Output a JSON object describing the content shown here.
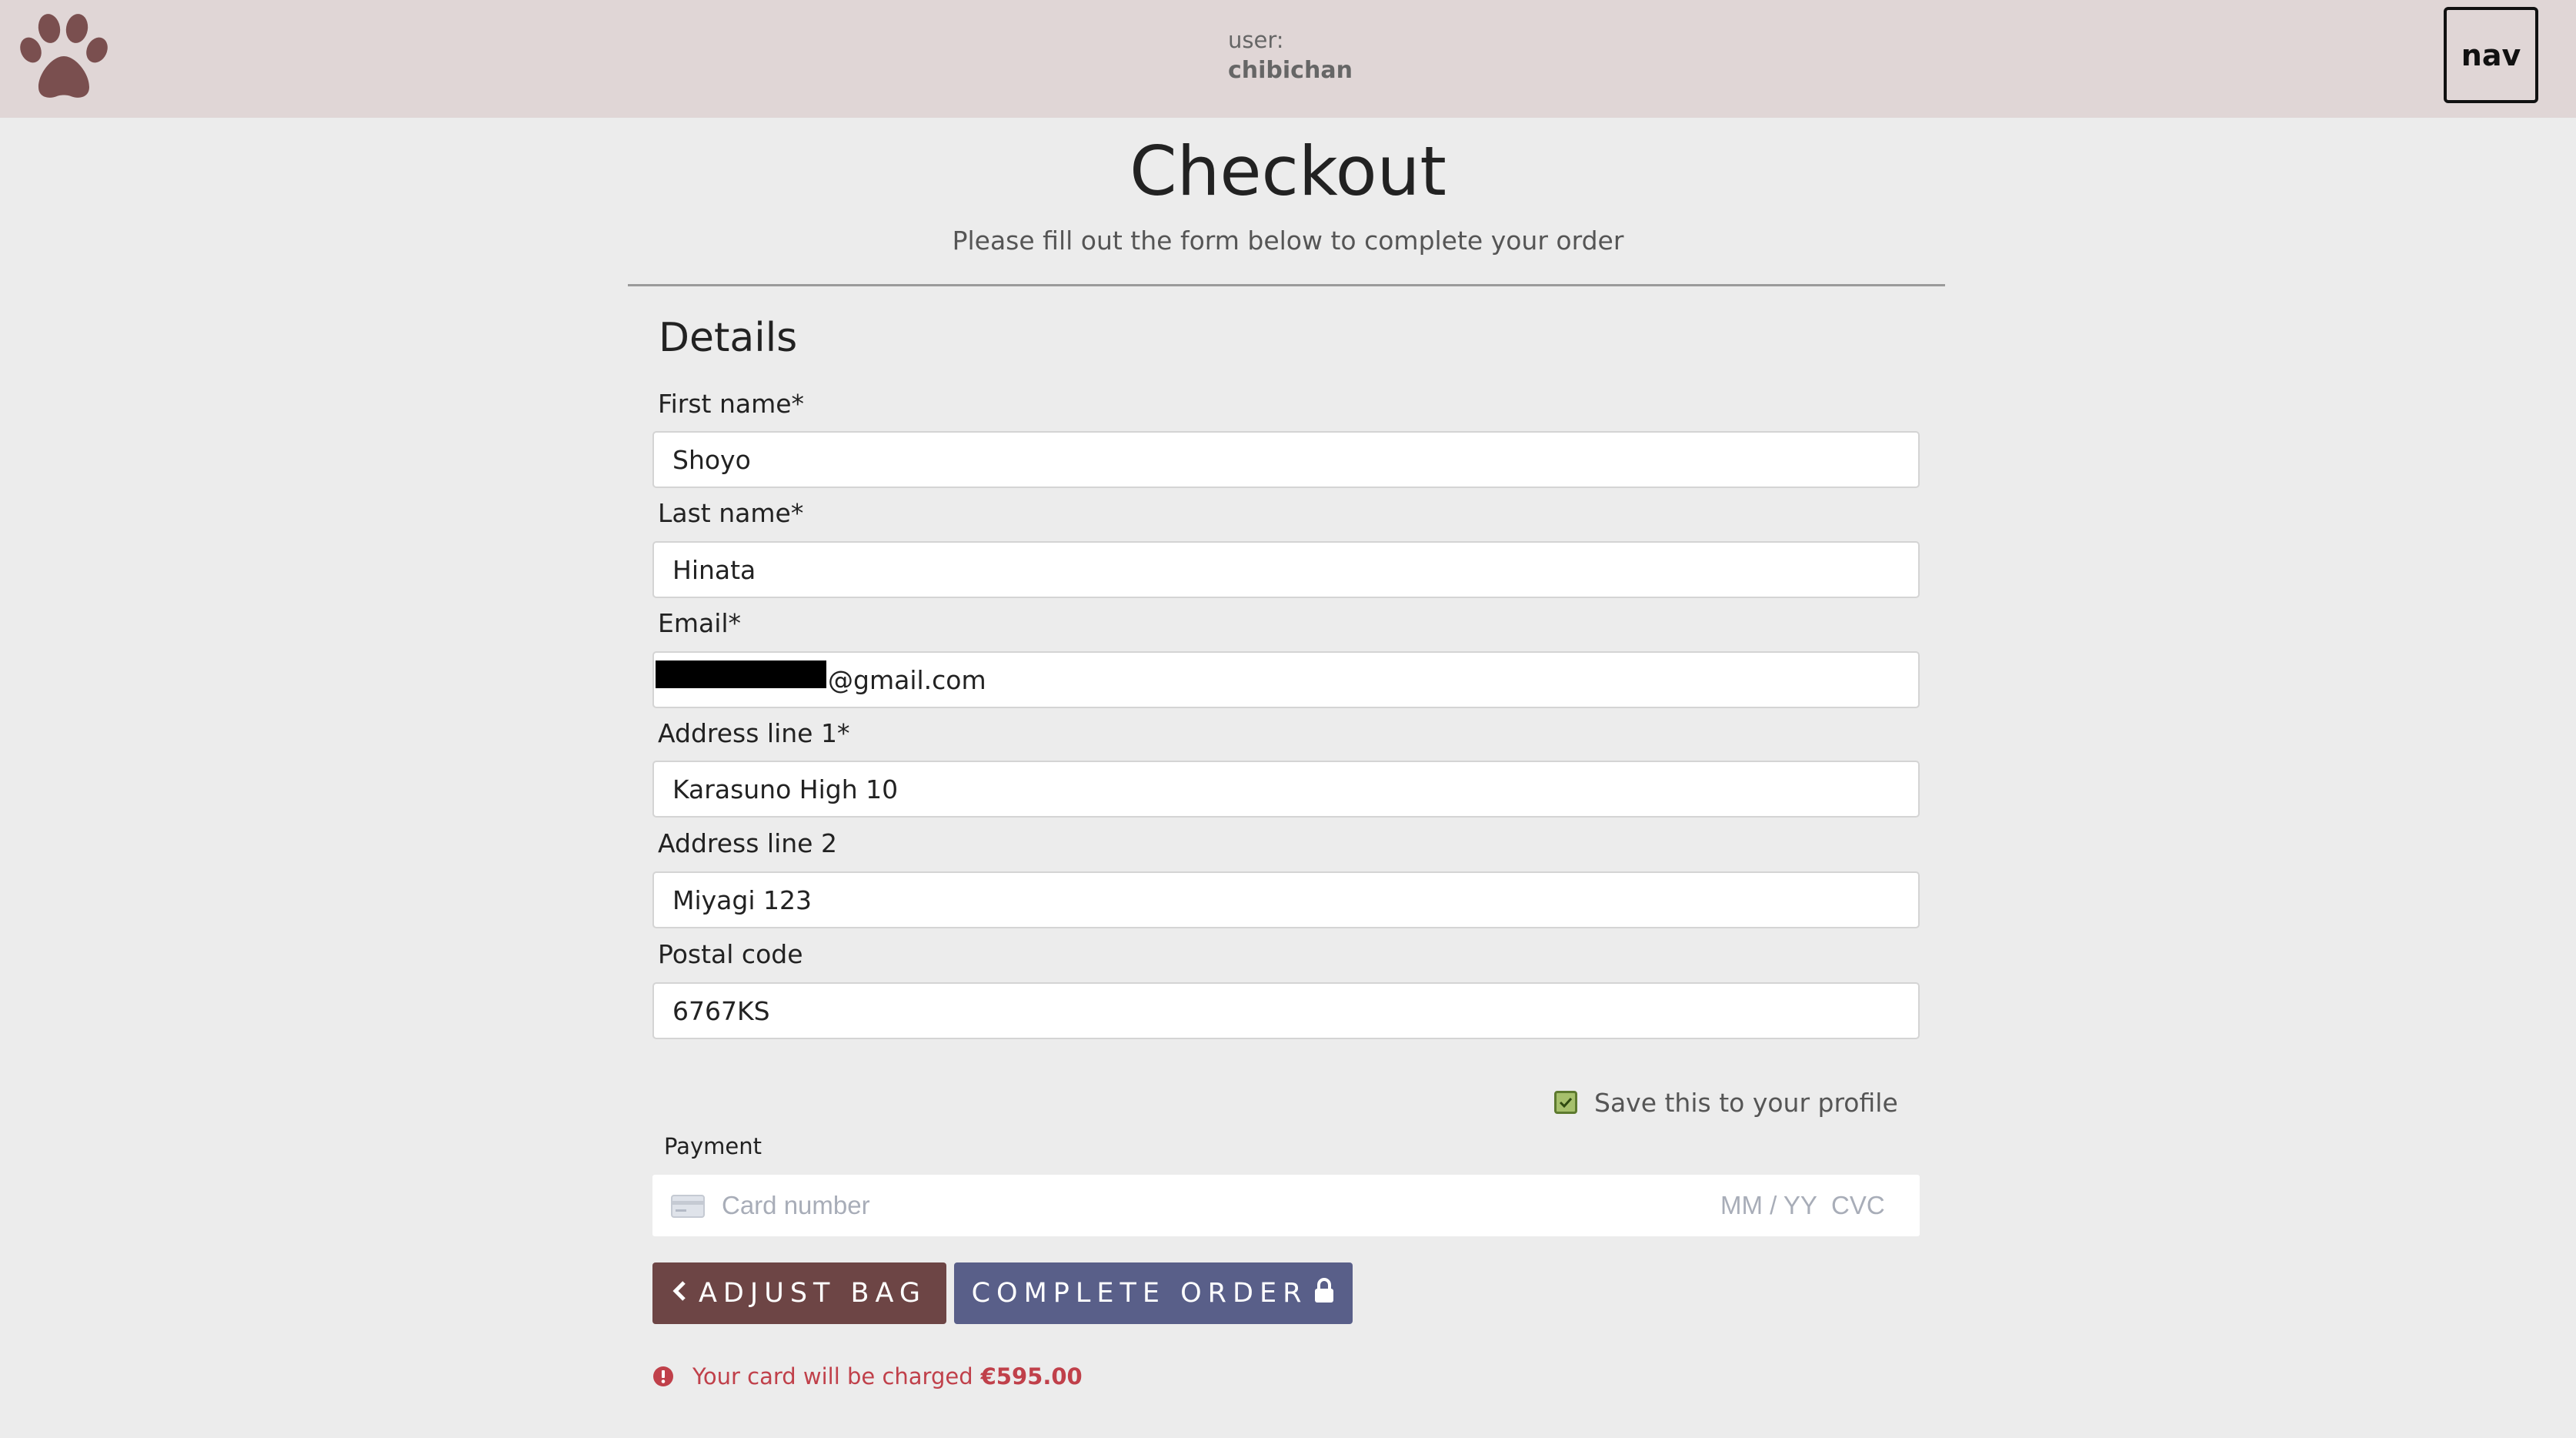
{
  "header": {
    "logo_icon": "paw-icon",
    "user_label": "user:",
    "username": "chibichan",
    "nav_label": "nav"
  },
  "page": {
    "title": "Checkout",
    "subtitle": "Please fill out the form below to complete your order"
  },
  "details": {
    "section_title": "Details",
    "first_name": {
      "label": "First name*",
      "value": "Shoyo"
    },
    "last_name": {
      "label": "Last name*",
      "value": "Hinata"
    },
    "email": {
      "label": "Email*",
      "value": "@gmail.com"
    },
    "address_line_1": {
      "label": "Address line 1*",
      "value": "Karasuno High 10"
    },
    "address_line_2": {
      "label": "Address line 2",
      "value": "Miyagi 123"
    },
    "postal_code": {
      "label": "Postal code",
      "value": "6767KS"
    },
    "save_to_profile": {
      "label": "Save this to your profile",
      "checked": true
    }
  },
  "payment": {
    "label": "Payment",
    "card_icon": "credit-card-icon",
    "card_number_placeholder": "Card number",
    "expiry_placeholder": "MM / YY",
    "cvc_placeholder": "CVC"
  },
  "actions": {
    "adjust_bag_label": "ADJUST BAG",
    "adjust_bag_icon": "chevron-left-icon",
    "complete_order_label": "COMPLETE ORDER",
    "complete_order_icon": "lock-icon"
  },
  "charge_notice": {
    "icon": "exclamation-circle-icon",
    "text": "Your card will be charged",
    "amount": "€595.00"
  },
  "colors": {
    "header_bg": "#e0d6d6",
    "page_bg": "#ececec",
    "logo": "#7a4f4f",
    "adjust_button": "#6d4545",
    "complete_button": "#595f89",
    "alert": "#c0404a",
    "checkbox": "#a6c06c"
  }
}
